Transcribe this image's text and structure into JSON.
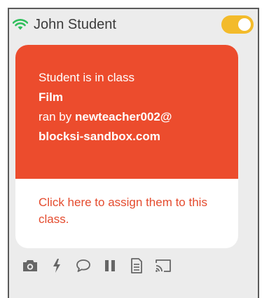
{
  "header": {
    "student_name": "John Student",
    "wifi_icon": "wifi-icon",
    "toggle_state": "on"
  },
  "status": {
    "line1": "Student is in class",
    "class_name": "Film",
    "ran_by_prefix": "ran by ",
    "teacher_part1": "newteacher002@",
    "teacher_part2": "blocksi-sandbox.com"
  },
  "assign": {
    "text": "Click here to assign them to this class."
  },
  "toolbar": {
    "icons": [
      "camera-icon",
      "lightning-icon",
      "chat-icon",
      "pause-icon",
      "document-icon",
      "cast-icon"
    ]
  },
  "colors": {
    "accent": "#ec4c2d",
    "toggle": "#f3bb2b",
    "wifi": "#2fbf5b",
    "icon_gray": "#666666"
  }
}
